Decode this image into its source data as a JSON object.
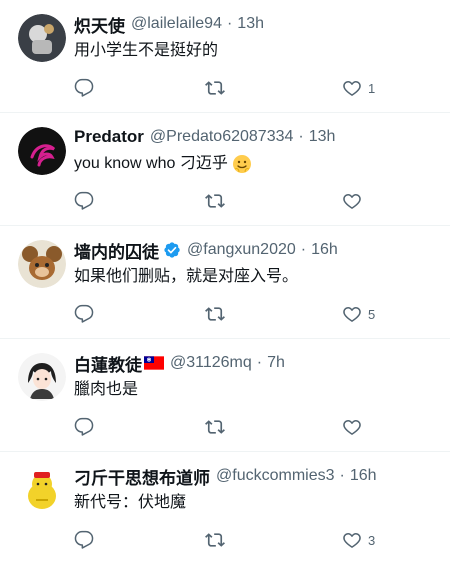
{
  "tweets": [
    {
      "name": "炽天使",
      "handle": "@lailelaile94",
      "time": "13h",
      "text": "用小学生不是挺好的",
      "like_count": "1"
    },
    {
      "name": "Predator",
      "handle": "@Predato62087334",
      "time": "13h",
      "text": "you know who 刁迈乎",
      "like_count": ""
    },
    {
      "name": "墙内的囚徒",
      "handle": "@fangxun2020",
      "time": "16h",
      "text": "如果他们删贴，就是对座入号。",
      "like_count": "5"
    },
    {
      "name": "白蓮教徒",
      "handle": "@31126mq",
      "time": "7h",
      "text": "臘肉也是",
      "like_count": ""
    },
    {
      "name": "刁斤干思想布道师",
      "handle": "@fuckcommies3",
      "time": "16h",
      "text": "新代号：伏地魔",
      "like_count": "3"
    }
  ],
  "separator": "·",
  "icons": {
    "reply": "reply-icon",
    "retweet": "retweet-icon",
    "like": "heart-icon",
    "verified": "verified-badge-icon",
    "flag": "taiwan-flag-icon",
    "emoji": "smiling-face-emoji-icon"
  },
  "colors": {
    "text": "#0f1419",
    "secondary": "#536471",
    "verified": "#1d9bf0",
    "divider": "#eff3f4"
  }
}
